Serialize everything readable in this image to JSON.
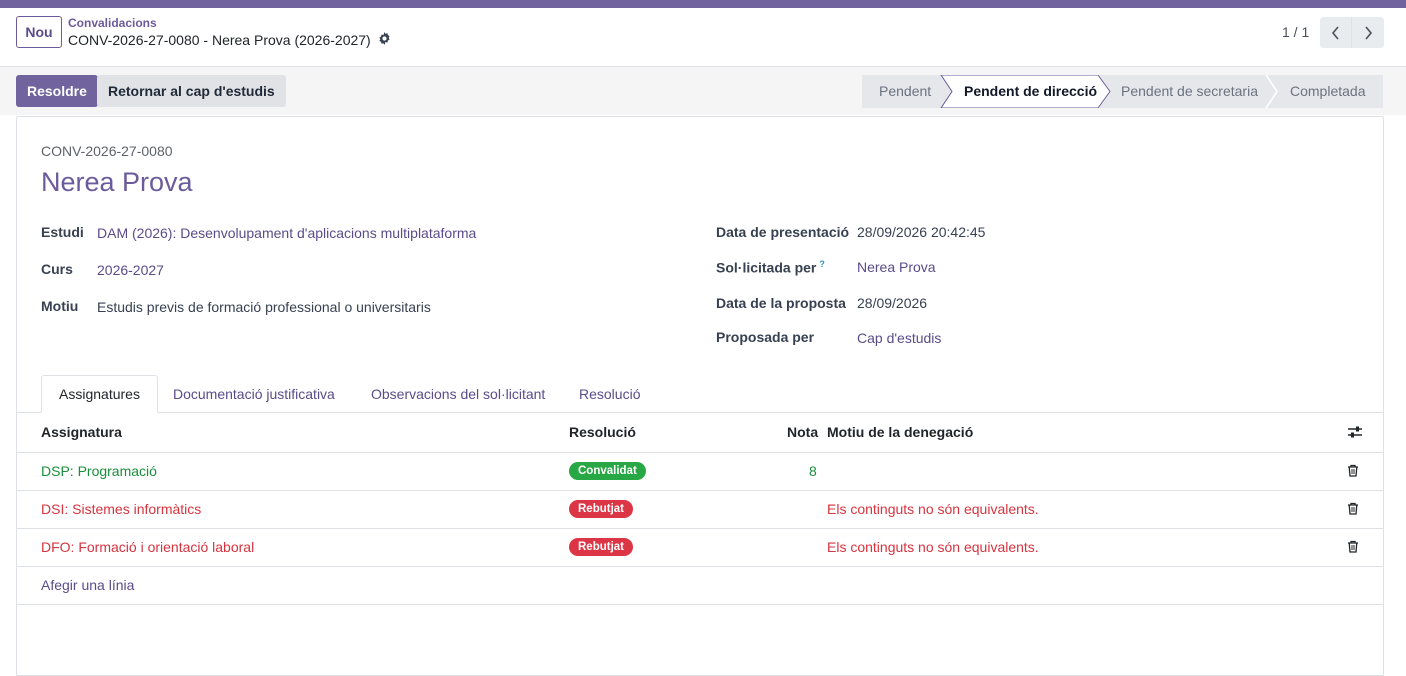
{
  "app": {
    "accent_color": "#71639e"
  },
  "breadcrumb": {
    "parent": "Convalidacions",
    "current": "CONV-2026-27-0080 - Nerea Prova (2026-2027)"
  },
  "control_panel": {
    "new_label": "Nou",
    "pager_value": "1 / 1"
  },
  "actions": {
    "resolve_label": "Resoldre",
    "return_label": "Retornar al cap d'estudis"
  },
  "statusbar": {
    "stages": [
      {
        "label": "Pendent",
        "active": false
      },
      {
        "label": "Pendent de direcció",
        "active": true
      },
      {
        "label": "Pendent de secretaria",
        "active": false
      },
      {
        "label": "Completada",
        "active": false
      }
    ]
  },
  "record": {
    "reference": "CONV-2026-27-0080",
    "name": "Nerea Prova"
  },
  "fields_left": [
    {
      "label": "Estudi",
      "value": "DAM (2026): Desenvolupament d'aplicacions multiplataforma"
    },
    {
      "label": "Curs",
      "value": "2026-2027"
    },
    {
      "label": "Motiu",
      "value": "Estudis previs de formació professional o universitaris"
    }
  ],
  "fields_right": [
    {
      "label": "Data de presentació",
      "value": "28/09/2026 20:42:45"
    },
    {
      "label": "Sol·licitada per",
      "help": "?",
      "value": "Nerea Prova"
    },
    {
      "label": "Data de la proposta",
      "value": "28/09/2026"
    },
    {
      "label": "Proposada per",
      "value": "Cap d'estudis"
    }
  ],
  "tabs": [
    {
      "label": "Assignatures",
      "active": true
    },
    {
      "label": "Documentació justificativa"
    },
    {
      "label": "Observacions del sol·licitant"
    },
    {
      "label": "Resolució"
    }
  ],
  "table": {
    "columns": [
      "Assignatura",
      "Resolució",
      "Nota",
      "Motiu de la denegació"
    ],
    "rows": [
      {
        "subject": "DSP: Programació",
        "resolution": "Convalidat",
        "grade": "8",
        "reason": "",
        "status": "ok"
      },
      {
        "subject": "DSI: Sistemes informàtics",
        "resolution": "Rebutjat",
        "grade": "",
        "reason": "Els continguts no són equivalents.",
        "status": "rejected"
      },
      {
        "subject": "DFO: Formació i orientació laboral",
        "resolution": "Rebutjat",
        "grade": "",
        "reason": "Els continguts no són equivalents.",
        "status": "rejected"
      }
    ],
    "add_line_label": "Afegir una línia"
  },
  "colors": {
    "ok": "#28a745",
    "ok_text": "#198f3a",
    "rejected": "#dc3545",
    "rejected_text": "#d6343f"
  }
}
